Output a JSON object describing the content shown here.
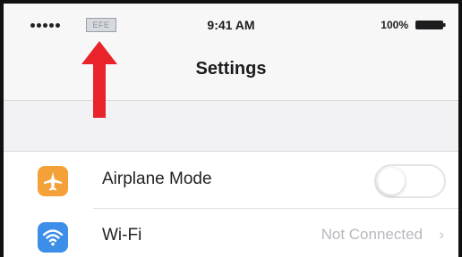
{
  "status_bar": {
    "carrier_badge": "EFE",
    "time": "9:41 AM",
    "battery_percent": "100%"
  },
  "nav": {
    "title": "Settings"
  },
  "rows": [
    {
      "label": "Airplane Mode",
      "icon": "airplane-icon",
      "toggle_on": false
    },
    {
      "label": "Wi-Fi",
      "icon": "wifi-icon",
      "value": "Not Connected",
      "chevron": "›"
    }
  ],
  "colors": {
    "annotation_arrow": "#e8232a",
    "airplane_icon_bg": "#f4a13a",
    "wifi_icon_bg": "#3c8ee8"
  }
}
